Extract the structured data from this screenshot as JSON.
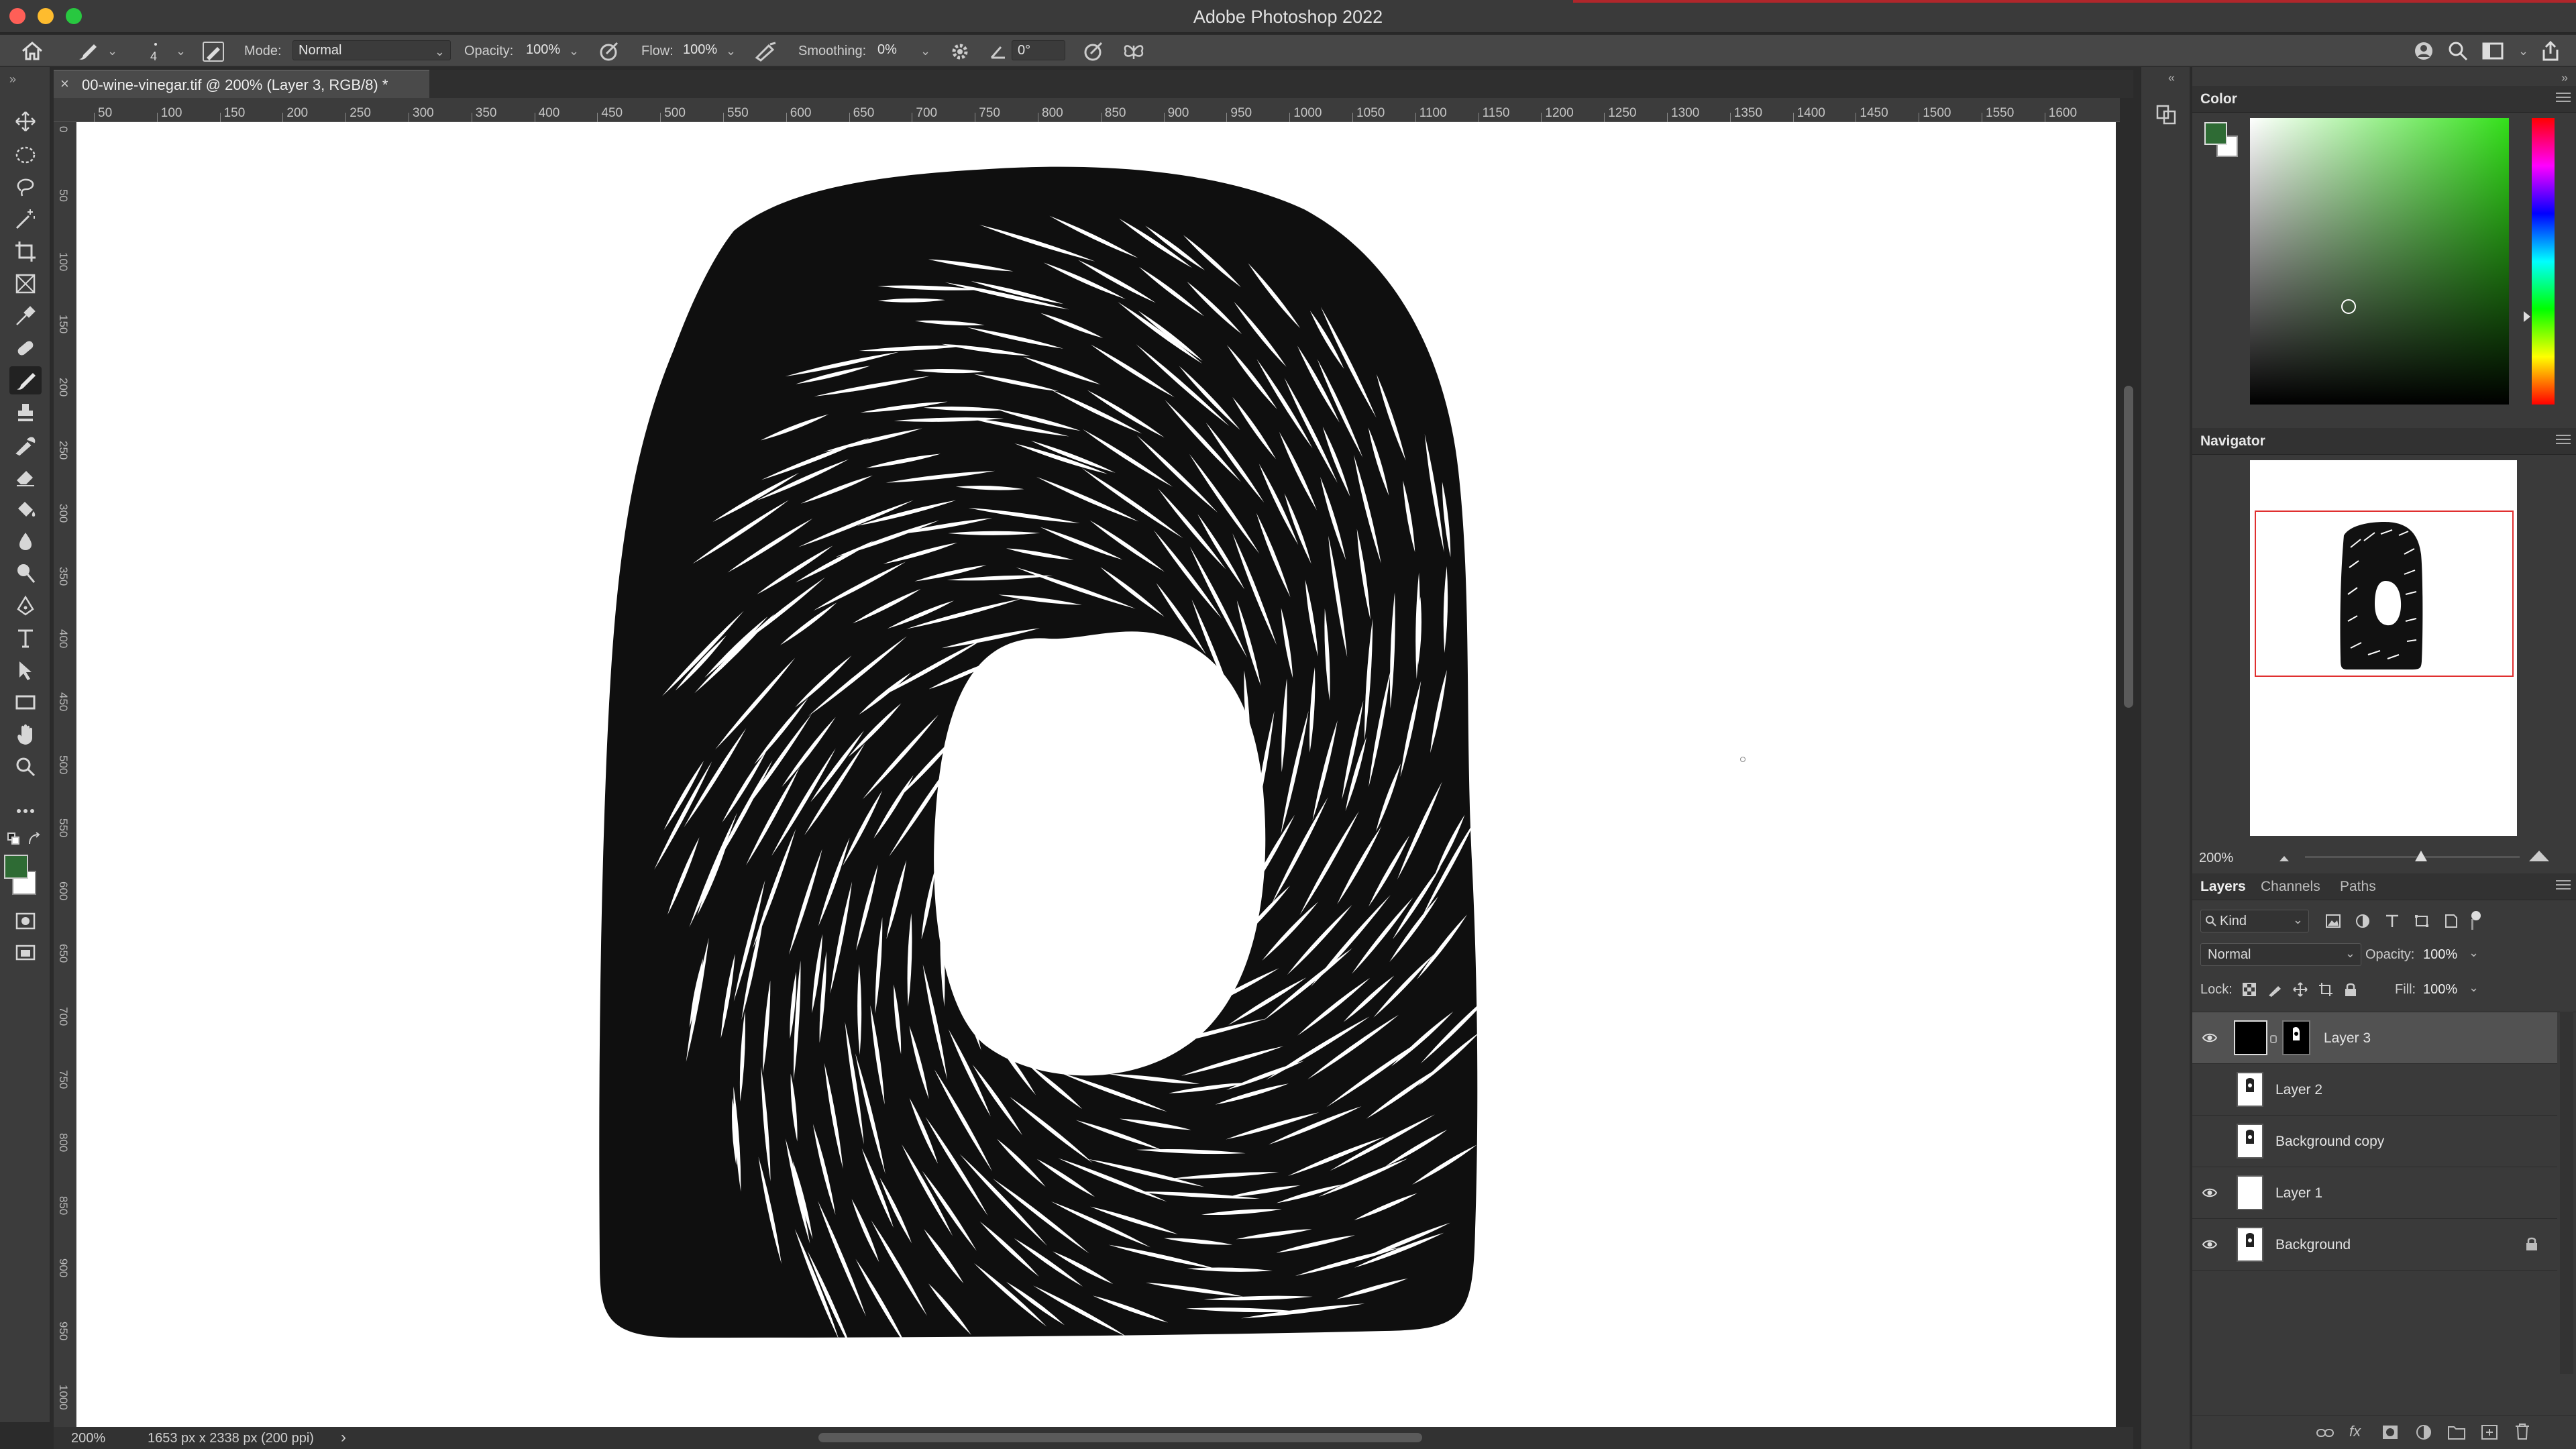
{
  "window": {
    "title": "Adobe Photoshop 2022"
  },
  "options": {
    "brush_size": "4",
    "mode_label": "Mode:",
    "mode_value": "Normal",
    "opacity_label": "Opacity:",
    "opacity_value": "100%",
    "flow_label": "Flow:",
    "flow_value": "100%",
    "smoothing_label": "Smoothing:",
    "smoothing_value": "0%",
    "angle_value": "0°"
  },
  "document": {
    "tab_title": "00-wine-vinegar.tif @ 200% (Layer 3, RGB/8) *"
  },
  "rulers": {
    "horizontal": [
      "50",
      "100",
      "150",
      "200",
      "250",
      "300",
      "350",
      "400",
      "450",
      "500",
      "550",
      "600",
      "650",
      "700",
      "750",
      "800",
      "850",
      "900",
      "950",
      "1000",
      "1050",
      "1100",
      "1150",
      "1200",
      "1250",
      "1300",
      "1350",
      "1400",
      "1450",
      "1500",
      "1550",
      "1600"
    ],
    "vertical": [
      "0",
      "50",
      "100",
      "150",
      "200",
      "250",
      "300",
      "350",
      "400",
      "450",
      "500",
      "550",
      "600",
      "650",
      "700",
      "750",
      "800",
      "850",
      "900",
      "950",
      "1000"
    ]
  },
  "status": {
    "zoom": "200%",
    "doc_size": "1653 px x 2338 px (200 ppi)",
    "arrow": "›"
  },
  "panels": {
    "color": {
      "title": "Color",
      "foreground": "#2e6b34",
      "background": "#ffffff"
    },
    "navigator": {
      "title": "Navigator",
      "zoom": "200%"
    },
    "layers": {
      "tabs": [
        "Layers",
        "Channels",
        "Paths"
      ],
      "filter_kind": "Kind",
      "blend_mode": "Normal",
      "opacity_label": "Opacity:",
      "opacity_value": "100%",
      "lock_label": "Lock:",
      "fill_label": "Fill:",
      "fill_value": "100%",
      "items": [
        {
          "name": "Layer 3",
          "visible": true,
          "selected": true
        },
        {
          "name": "Layer 2",
          "visible": false,
          "selected": false
        },
        {
          "name": "Background copy",
          "visible": false,
          "selected": false
        },
        {
          "name": "Layer 1",
          "visible": true,
          "selected": false
        },
        {
          "name": "Background",
          "visible": true,
          "selected": false,
          "locked": true
        }
      ]
    }
  },
  "icons": [
    "home-icon",
    "brush-icon",
    "move-icon",
    "lasso-icon",
    "crop-icon",
    "eyedropper-icon",
    "eraser-icon",
    "pen-icon",
    "type-icon",
    "hand-icon",
    "zoom-icon",
    "eye-icon",
    "lock-icon",
    "search-icon",
    "share-icon",
    "settings-icon"
  ]
}
